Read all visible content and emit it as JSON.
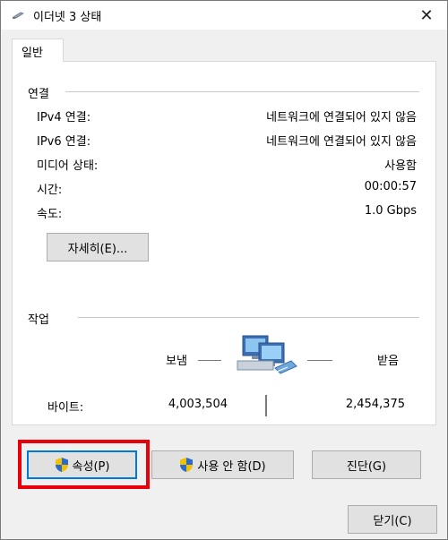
{
  "window": {
    "title": "이더넷 3 상태",
    "close_label": "✕"
  },
  "tab": {
    "label": "일반"
  },
  "connection": {
    "heading": "연결",
    "rows": [
      {
        "label": "IPv4 연결:",
        "value": "네트워크에 연결되어 있지 않음"
      },
      {
        "label": "IPv6 연결:",
        "value": "네트워크에 연결되어 있지 않음"
      },
      {
        "label": "미디어 상태:",
        "value": "사용함"
      },
      {
        "label": "시간:",
        "value": "00:00:57"
      },
      {
        "label": "속도:",
        "value": "1.0 Gbps"
      }
    ],
    "details_button": "자세히(E)..."
  },
  "activity": {
    "heading": "작업",
    "sent_label": "보냄",
    "received_label": "받음",
    "bytes_label": "바이트:",
    "bytes_sent": "4,003,504",
    "bytes_received": "2,454,375"
  },
  "buttons": {
    "properties": "속성(P)",
    "disable": "사용 안 함(D)",
    "diagnose": "진단(G)",
    "close": "닫기(C)"
  },
  "icons": {
    "title": "network-adapter-icon",
    "activity": "network-computers-icon",
    "shield": "uac-shield-icon"
  },
  "colors": {
    "highlight": "#e8000b",
    "default_button_border": "#0078d7"
  }
}
